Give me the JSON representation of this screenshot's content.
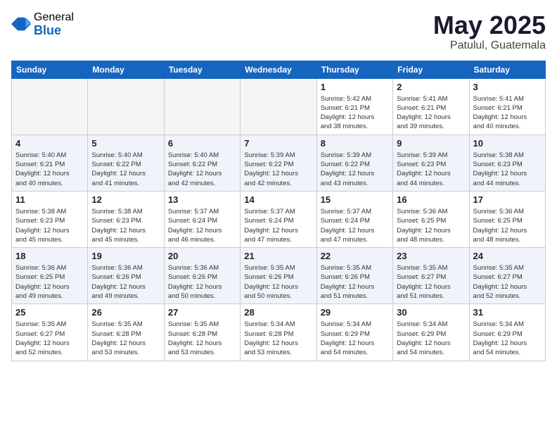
{
  "logo": {
    "general": "General",
    "blue": "Blue"
  },
  "title": "May 2025",
  "subtitle": "Patulul, Guatemala",
  "days_of_week": [
    "Sunday",
    "Monday",
    "Tuesday",
    "Wednesday",
    "Thursday",
    "Friday",
    "Saturday"
  ],
  "weeks": [
    [
      {
        "day": "",
        "info": ""
      },
      {
        "day": "",
        "info": ""
      },
      {
        "day": "",
        "info": ""
      },
      {
        "day": "",
        "info": ""
      },
      {
        "day": "1",
        "info": "Sunrise: 5:42 AM\nSunset: 6:21 PM\nDaylight: 12 hours\nand 38 minutes."
      },
      {
        "day": "2",
        "info": "Sunrise: 5:41 AM\nSunset: 6:21 PM\nDaylight: 12 hours\nand 39 minutes."
      },
      {
        "day": "3",
        "info": "Sunrise: 5:41 AM\nSunset: 6:21 PM\nDaylight: 12 hours\nand 40 minutes."
      }
    ],
    [
      {
        "day": "4",
        "info": "Sunrise: 5:40 AM\nSunset: 6:21 PM\nDaylight: 12 hours\nand 40 minutes."
      },
      {
        "day": "5",
        "info": "Sunrise: 5:40 AM\nSunset: 6:22 PM\nDaylight: 12 hours\nand 41 minutes."
      },
      {
        "day": "6",
        "info": "Sunrise: 5:40 AM\nSunset: 6:22 PM\nDaylight: 12 hours\nand 42 minutes."
      },
      {
        "day": "7",
        "info": "Sunrise: 5:39 AM\nSunset: 6:22 PM\nDaylight: 12 hours\nand 42 minutes."
      },
      {
        "day": "8",
        "info": "Sunrise: 5:39 AM\nSunset: 6:22 PM\nDaylight: 12 hours\nand 43 minutes."
      },
      {
        "day": "9",
        "info": "Sunrise: 5:39 AM\nSunset: 6:23 PM\nDaylight: 12 hours\nand 44 minutes."
      },
      {
        "day": "10",
        "info": "Sunrise: 5:38 AM\nSunset: 6:23 PM\nDaylight: 12 hours\nand 44 minutes."
      }
    ],
    [
      {
        "day": "11",
        "info": "Sunrise: 5:38 AM\nSunset: 6:23 PM\nDaylight: 12 hours\nand 45 minutes."
      },
      {
        "day": "12",
        "info": "Sunrise: 5:38 AM\nSunset: 6:23 PM\nDaylight: 12 hours\nand 45 minutes."
      },
      {
        "day": "13",
        "info": "Sunrise: 5:37 AM\nSunset: 6:24 PM\nDaylight: 12 hours\nand 46 minutes."
      },
      {
        "day": "14",
        "info": "Sunrise: 5:37 AM\nSunset: 6:24 PM\nDaylight: 12 hours\nand 47 minutes."
      },
      {
        "day": "15",
        "info": "Sunrise: 5:37 AM\nSunset: 6:24 PM\nDaylight: 12 hours\nand 47 minutes."
      },
      {
        "day": "16",
        "info": "Sunrise: 5:36 AM\nSunset: 6:25 PM\nDaylight: 12 hours\nand 48 minutes."
      },
      {
        "day": "17",
        "info": "Sunrise: 5:36 AM\nSunset: 6:25 PM\nDaylight: 12 hours\nand 48 minutes."
      }
    ],
    [
      {
        "day": "18",
        "info": "Sunrise: 5:36 AM\nSunset: 6:25 PM\nDaylight: 12 hours\nand 49 minutes."
      },
      {
        "day": "19",
        "info": "Sunrise: 5:36 AM\nSunset: 6:26 PM\nDaylight: 12 hours\nand 49 minutes."
      },
      {
        "day": "20",
        "info": "Sunrise: 5:36 AM\nSunset: 6:26 PM\nDaylight: 12 hours\nand 50 minutes."
      },
      {
        "day": "21",
        "info": "Sunrise: 5:35 AM\nSunset: 6:26 PM\nDaylight: 12 hours\nand 50 minutes."
      },
      {
        "day": "22",
        "info": "Sunrise: 5:35 AM\nSunset: 6:26 PM\nDaylight: 12 hours\nand 51 minutes."
      },
      {
        "day": "23",
        "info": "Sunrise: 5:35 AM\nSunset: 6:27 PM\nDaylight: 12 hours\nand 51 minutes."
      },
      {
        "day": "24",
        "info": "Sunrise: 5:35 AM\nSunset: 6:27 PM\nDaylight: 12 hours\nand 52 minutes."
      }
    ],
    [
      {
        "day": "25",
        "info": "Sunrise: 5:35 AM\nSunset: 6:27 PM\nDaylight: 12 hours\nand 52 minutes."
      },
      {
        "day": "26",
        "info": "Sunrise: 5:35 AM\nSunset: 6:28 PM\nDaylight: 12 hours\nand 53 minutes."
      },
      {
        "day": "27",
        "info": "Sunrise: 5:35 AM\nSunset: 6:28 PM\nDaylight: 12 hours\nand 53 minutes."
      },
      {
        "day": "28",
        "info": "Sunrise: 5:34 AM\nSunset: 6:28 PM\nDaylight: 12 hours\nand 53 minutes."
      },
      {
        "day": "29",
        "info": "Sunrise: 5:34 AM\nSunset: 6:29 PM\nDaylight: 12 hours\nand 54 minutes."
      },
      {
        "day": "30",
        "info": "Sunrise: 5:34 AM\nSunset: 6:29 PM\nDaylight: 12 hours\nand 54 minutes."
      },
      {
        "day": "31",
        "info": "Sunrise: 5:34 AM\nSunset: 6:29 PM\nDaylight: 12 hours\nand 54 minutes."
      }
    ]
  ]
}
